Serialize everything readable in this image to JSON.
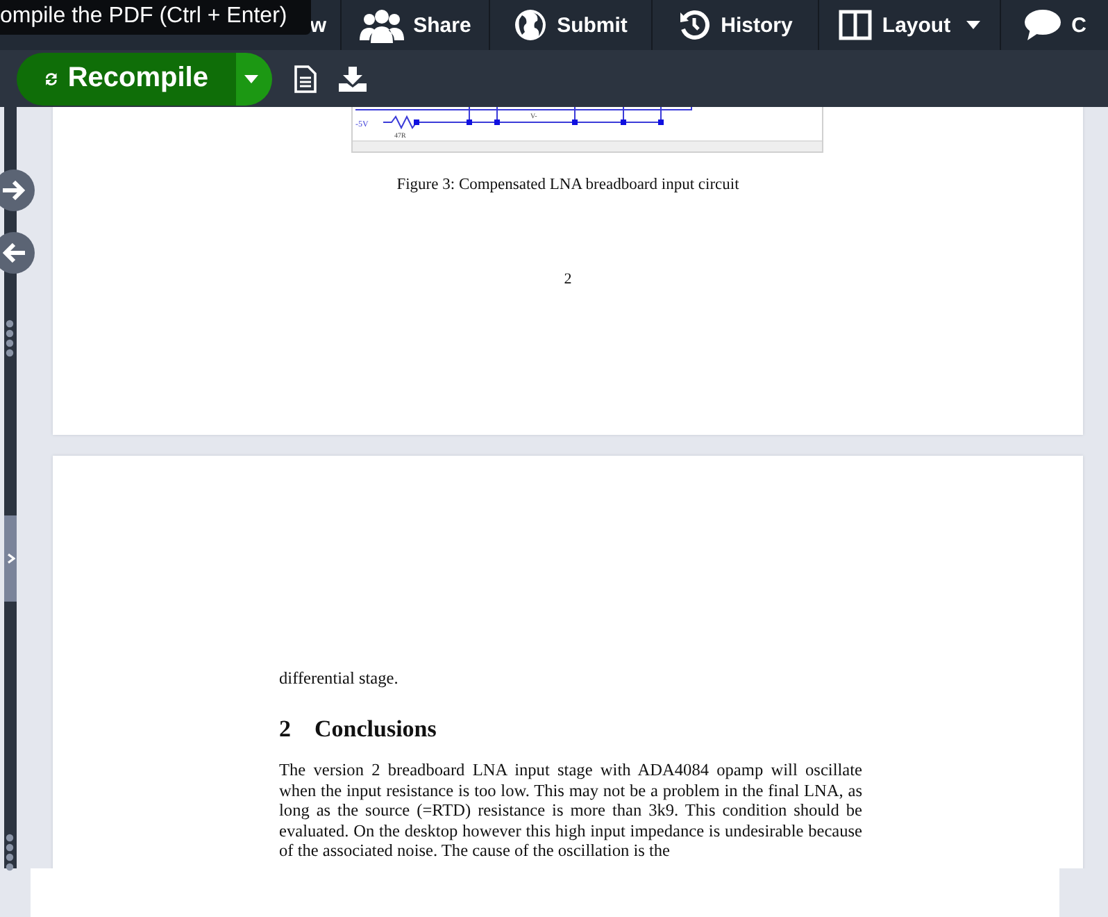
{
  "topbar": {
    "tooltip": "ompile the PDF (Ctrl + Enter)",
    "menu": [
      {
        "label": "w",
        "dropdown": false
      },
      {
        "label": "Share",
        "dropdown": false
      },
      {
        "label": "Submit",
        "dropdown": false
      },
      {
        "label": "History",
        "dropdown": false
      },
      {
        "label": "Layout",
        "dropdown": true
      },
      {
        "label": "C",
        "dropdown": false
      }
    ]
  },
  "toolbar": {
    "recompile": "Recompile"
  },
  "pdf": {
    "figure": {
      "labels": [
        "-5V",
        "47R",
        "V-"
      ]
    },
    "caption": "Figure 3: Compensated LNA breadboard input circuit",
    "page_number": "2",
    "intro_line": "differential stage.",
    "section": {
      "number": "2",
      "title": "Conclusions"
    },
    "paragraph": "The version 2 breadboard LNA input stage with ADA4084 opamp will oscillate when the input resistance is too low.  This may not be a problem in the final LNA, as long as the source (=RTD) resistance is more than 3k9.  This condition should be evaluated.  On the desktop however this high input impedance is undesirable because of the associated noise.  The cause of the oscillation is the"
  }
}
